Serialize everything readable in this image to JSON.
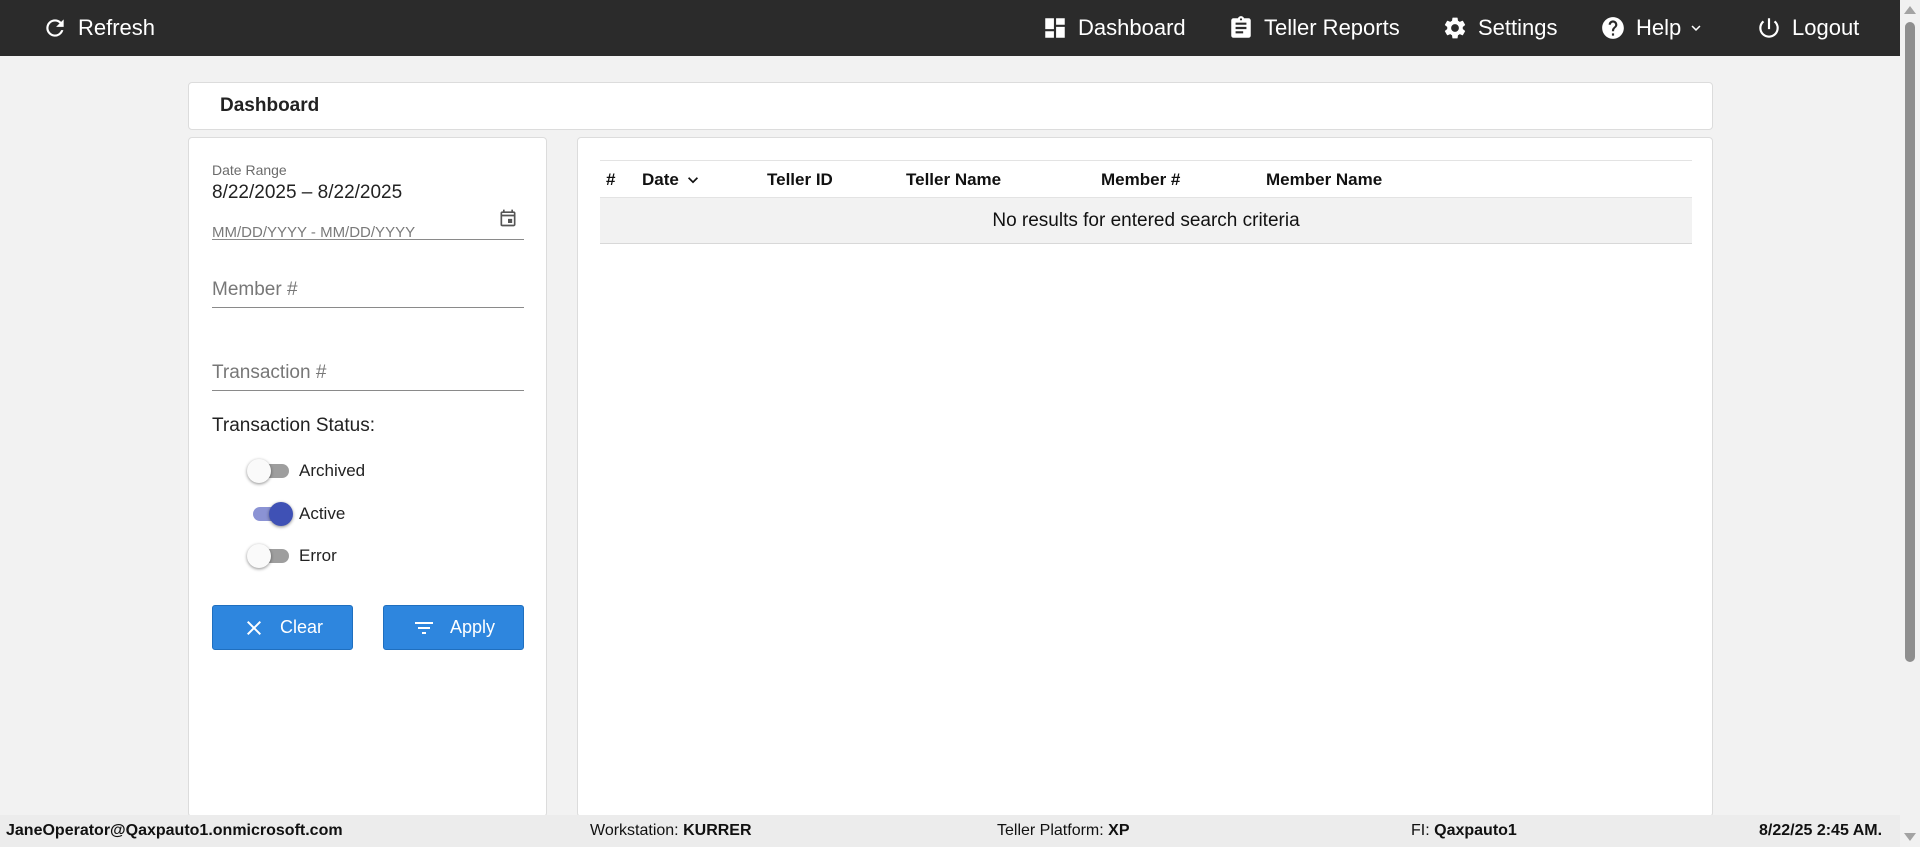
{
  "topbar": {
    "refresh_label": "Refresh",
    "dashboard_label": "Dashboard",
    "teller_reports_label": "Teller Reports",
    "settings_label": "Settings",
    "help_label": "Help",
    "logout_label": "Logout",
    "background": "#2b2b2b"
  },
  "page": {
    "title": "Dashboard"
  },
  "filters": {
    "date_range_label": "Date Range",
    "date_range_value": "8/22/2025 – 8/22/2025",
    "date_range_hint": "MM/DD/YYYY - MM/DD/YYYY",
    "member_placeholder": "Member #",
    "transaction_placeholder": "Transaction #",
    "status_label": "Transaction Status:",
    "statuses": [
      {
        "label": "Archived",
        "on": false
      },
      {
        "label": "Active",
        "on": true
      },
      {
        "label": "Error",
        "on": false
      }
    ],
    "clear_label": "Clear",
    "apply_label": "Apply",
    "button_color": "#2e86de",
    "toggle_on_color": "#3f51b5"
  },
  "results": {
    "columns": [
      "#",
      "Date",
      "Teller ID",
      "Teller Name",
      "Member #",
      "Member Name"
    ],
    "empty_message": "No results for entered search criteria"
  },
  "footer": {
    "user": "JaneOperator@Qaxpauto1.onmicrosoft.com",
    "workstation_label": "Workstation:",
    "workstation_value": "KURRER",
    "platform_label": "Teller Platform:",
    "platform_value": "XP",
    "fi_label": "FI:",
    "fi_value": "Qaxpauto1",
    "timestamp": "8/22/25 2:45 AM."
  }
}
